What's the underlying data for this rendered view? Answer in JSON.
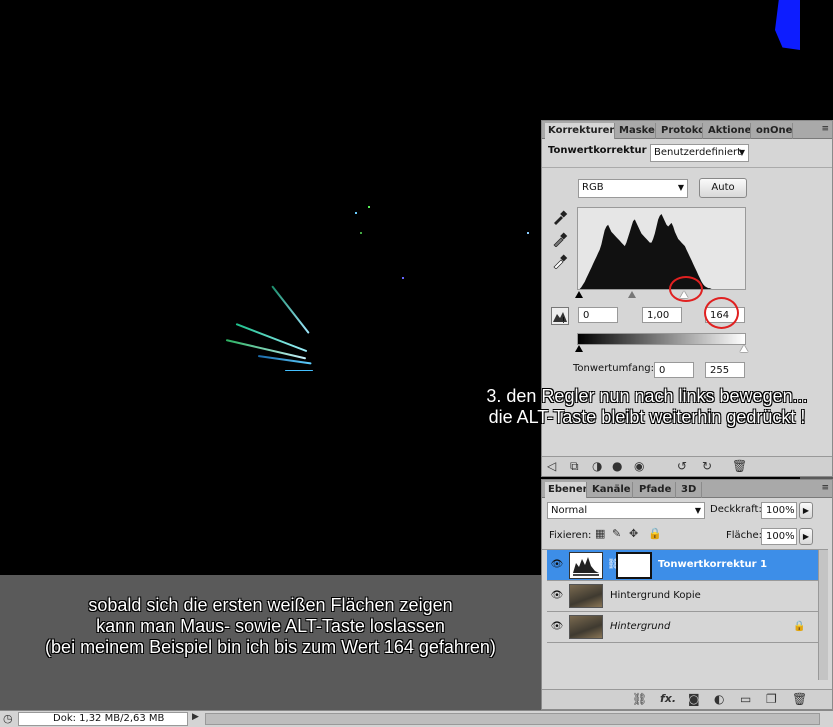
{
  "captions": {
    "right": {
      "line1": "3. den Regler nun nach links bewegen...",
      "line2": "die ALT-Taste bleibt weiterhin gedrückt !"
    },
    "bottom": {
      "line1": "sobald sich die ersten weißen Flächen zeigen",
      "line2": "kann man Maus- sowie ALT-Taste loslassen",
      "line3": "(bei meinem Beispiel bin ich bis zum Wert 164 gefahren)"
    }
  },
  "adjust_panel": {
    "tabs": [
      "Korrekturen",
      "Masken",
      "Protokol",
      "Aktionen",
      "onOne"
    ],
    "menu_icon": "≡",
    "title": "Tonwertkorrektur",
    "preset": "Benutzerdefiniert",
    "channel": "RGB",
    "auto_label": "Auto",
    "input_black": "0",
    "input_gamma": "1,00",
    "input_white": "164",
    "output_label": "Tonwertumfang:",
    "output_black": "0",
    "output_white": "255",
    "histogram": [
      0,
      0,
      2,
      5,
      8,
      12,
      16,
      20,
      24,
      28,
      32,
      36,
      40,
      44,
      50,
      58,
      66,
      70,
      72,
      68,
      64,
      62,
      60,
      58,
      56,
      54,
      52,
      50,
      48,
      52,
      58,
      64,
      70,
      76,
      78,
      74,
      70,
      66,
      62,
      60,
      58,
      56,
      54,
      52,
      52,
      56,
      62,
      70,
      78,
      82,
      84,
      80,
      76,
      72,
      70,
      72,
      74,
      70,
      64,
      60,
      56,
      54,
      52,
      50,
      48,
      44,
      40,
      36,
      32,
      28,
      24,
      20,
      16,
      12,
      8,
      5,
      3,
      2,
      1,
      1,
      0,
      0,
      0,
      0,
      0,
      0,
      0,
      0,
      0,
      0,
      0,
      0,
      0,
      0,
      0,
      0,
      0,
      0,
      0,
      0
    ]
  },
  "layers_panel": {
    "tabs": [
      "Ebenen",
      "Kanäle",
      "Pfade",
      "3D"
    ],
    "blend_mode": "Normal",
    "opacity_label": "Deckkraft:",
    "opacity": "100%",
    "lock_label": "Fixieren:",
    "fill_label": "Fläche:",
    "fill": "100%",
    "layers": [
      {
        "name": "Tonwertkorrektur 1"
      },
      {
        "name": "Hintergrund Kopie"
      },
      {
        "name": "Hintergrund"
      }
    ]
  },
  "status": {
    "doc": "Dok: 1,32 MB/2,63 MB"
  }
}
